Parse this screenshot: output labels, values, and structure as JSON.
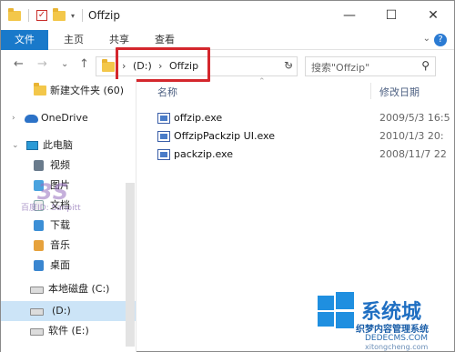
{
  "window": {
    "title": "Offzip",
    "minimize_glyph": "—",
    "maximize_glyph": "☐",
    "close_glyph": "✕"
  },
  "ribbon": {
    "tabs": [
      "文件",
      "主页",
      "共享",
      "查看"
    ]
  },
  "address": {
    "drive": "(D:)",
    "folder": "Offzip",
    "separator": "›",
    "search_placeholder": "搜索\"Offzip\""
  },
  "navigation": {
    "back_glyph": "←",
    "forward_glyph": "→",
    "recent_glyph": "⌄",
    "up_glyph": "↑"
  },
  "nav_pane": {
    "items": [
      {
        "label": "新建文件夹 (60)",
        "icon": "folder-icon"
      },
      {
        "label": "OneDrive",
        "icon": "onedrive-icon"
      },
      {
        "label": "此电脑",
        "icon": "computer-icon"
      },
      {
        "label": "视频",
        "icon": "video-icon"
      },
      {
        "label": "图片",
        "icon": "pictures-icon"
      },
      {
        "label": "文档",
        "icon": "documents-icon"
      },
      {
        "label": "下载",
        "icon": "downloads-icon"
      },
      {
        "label": "音乐",
        "icon": "music-icon"
      },
      {
        "label": "桌面",
        "icon": "desktop-icon"
      },
      {
        "label": "本地磁盘 (C:)",
        "icon": "drive-icon"
      },
      {
        "label": "(D:)",
        "icon": "drive-icon"
      },
      {
        "label": "软件 (E:)",
        "icon": "drive-icon"
      }
    ],
    "selected_index": 10
  },
  "columns": {
    "name": "名称",
    "date": "修改日期"
  },
  "files": [
    {
      "name": "offzip.exe",
      "date": "2009/5/3 16:5"
    },
    {
      "name": "OffzipPackzip UI.exe",
      "date": "2010/1/3 20:"
    },
    {
      "name": "packzip.exe",
      "date": "2008/11/7 22"
    }
  ],
  "watermarks": {
    "left_logo": "3S",
    "left_text": "百度ID: Sanpitt",
    "right_big": "系统城",
    "right_line1": "织梦内容管理系统",
    "right_line2": "DEDECMS.COM",
    "right_line3": "xitongcheng.com"
  },
  "colors": {
    "accent": "#1979ca",
    "selection": "#cce4f7",
    "highlight_box": "#d4272d"
  }
}
